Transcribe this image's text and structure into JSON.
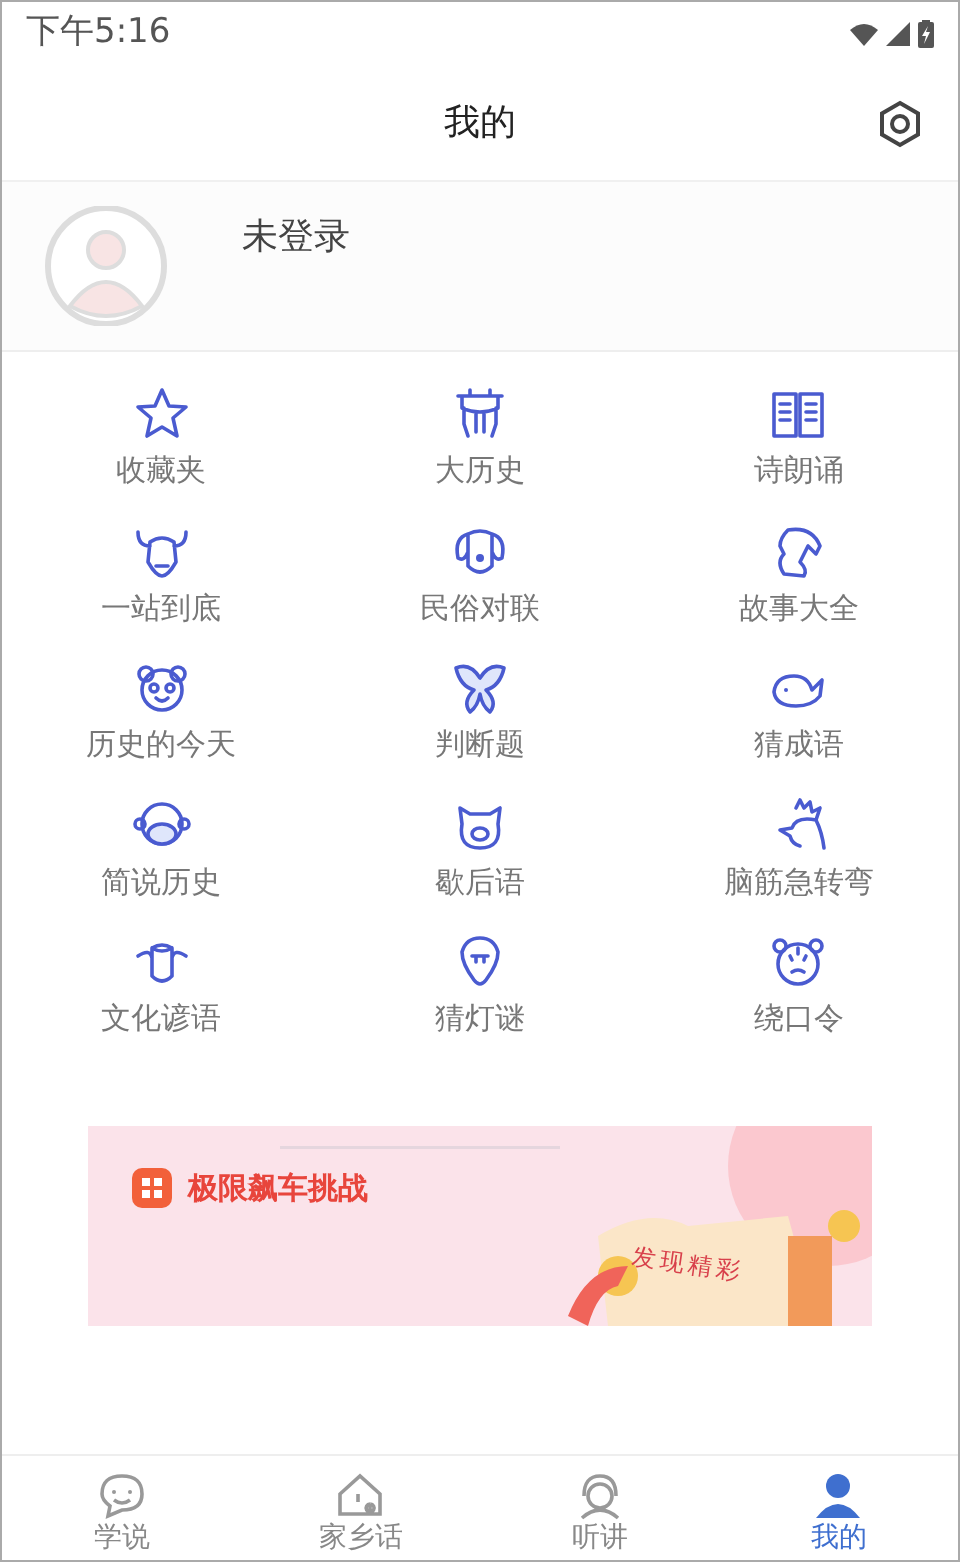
{
  "status_bar": {
    "time": "下午5:16"
  },
  "header": {
    "title": "我的"
  },
  "profile": {
    "name": "未登录"
  },
  "menu": [
    {
      "label": "收藏夹"
    },
    {
      "label": "大历史"
    },
    {
      "label": "诗朗诵"
    },
    {
      "label": "一站到底"
    },
    {
      "label": "民俗对联"
    },
    {
      "label": "故事大全"
    },
    {
      "label": "历史的今天"
    },
    {
      "label": "判断题"
    },
    {
      "label": "猜成语"
    },
    {
      "label": "简说历史"
    },
    {
      "label": "歇后语"
    },
    {
      "label": "脑筋急转弯"
    },
    {
      "label": "文化谚语"
    },
    {
      "label": "猜灯谜"
    },
    {
      "label": "绕口令"
    }
  ],
  "banner": {
    "title": "极限飙车挑战",
    "tag": "发现精彩"
  },
  "bottom_nav": [
    {
      "label": "学说",
      "selected": false
    },
    {
      "label": "家乡话",
      "selected": false
    },
    {
      "label": "听讲",
      "selected": false
    },
    {
      "label": "我的",
      "selected": true
    }
  ]
}
